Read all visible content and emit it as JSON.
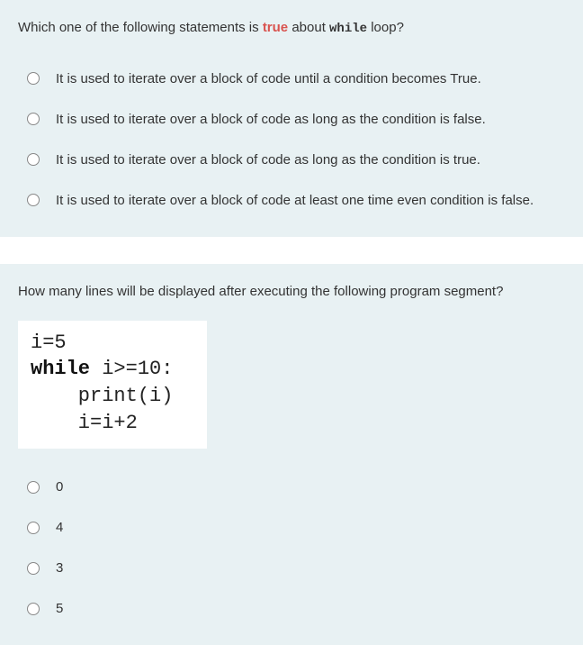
{
  "questions": [
    {
      "prefix": "Which one of the following statements is ",
      "bold_red": "true",
      "middle": " about ",
      "mono": "while",
      "suffix": " loop?",
      "options": [
        "It is used to iterate over a block of code until a condition becomes True.",
        "It is used to iterate over a block of code as long as the condition is false.",
        "It is used to iterate over a block of code as long as the condition is true.",
        "It is used to iterate over a block of code at least one time even condition is false."
      ]
    },
    {
      "text": "How many lines will be displayed after executing the following program segment?",
      "code": {
        "line1": "i=5",
        "line2_keyword": "while",
        "line2_rest": " i>=10:",
        "line3": "    print(i)",
        "line4": "    i=i+2"
      },
      "options": [
        "0",
        "4",
        "3",
        "5"
      ]
    }
  ]
}
